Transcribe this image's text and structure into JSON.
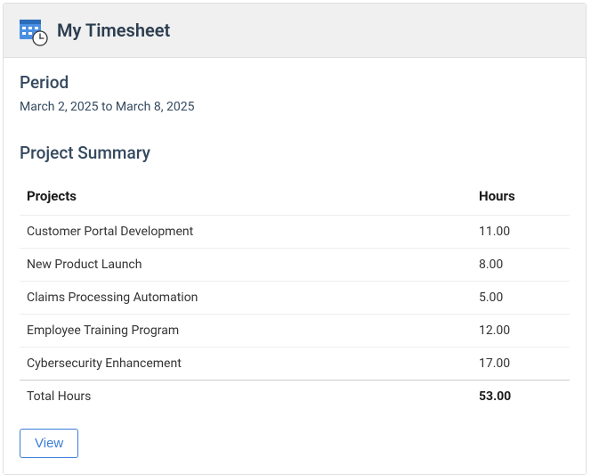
{
  "header": {
    "title": "My Timesheet"
  },
  "period": {
    "label": "Period",
    "text": "March 2, 2025 to March 8, 2025"
  },
  "summary": {
    "title": "Project Summary",
    "columns": {
      "projects": "Projects",
      "hours": "Hours"
    },
    "rows": [
      {
        "project": "Customer Portal Development",
        "hours": "11.00"
      },
      {
        "project": "New Product Launch",
        "hours": "8.00"
      },
      {
        "project": "Claims Processing Automation",
        "hours": "5.00"
      },
      {
        "project": "Employee Training Program",
        "hours": "12.00"
      },
      {
        "project": "Cybersecurity Enhancement",
        "hours": "17.00"
      }
    ],
    "total": {
      "label": "Total Hours",
      "hours": "53.00"
    }
  },
  "actions": {
    "view": "View"
  }
}
